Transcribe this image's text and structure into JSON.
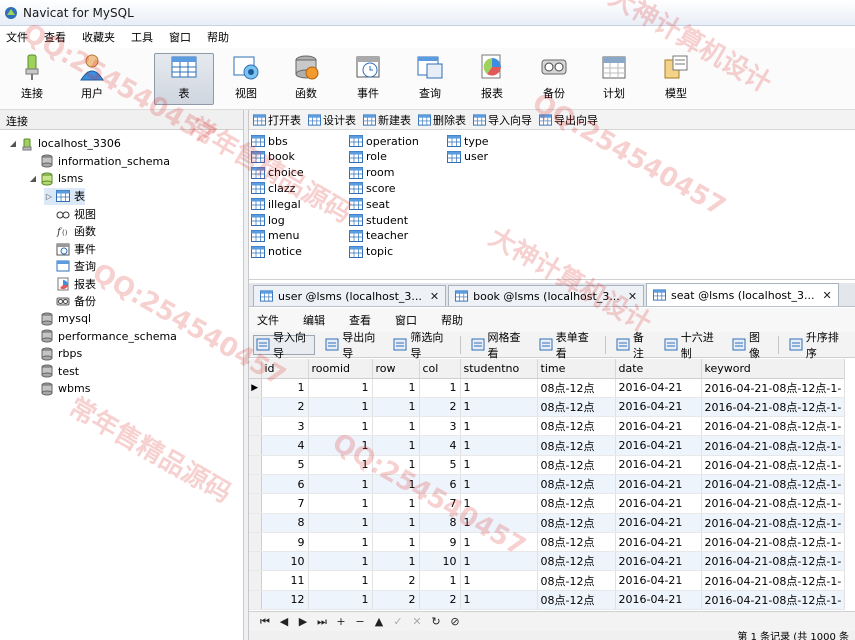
{
  "window": {
    "title": "Navicat for MySQL"
  },
  "menubar": [
    "文件",
    "查看",
    "收藏夹",
    "工具",
    "窗口",
    "帮助"
  ],
  "toolbar": [
    {
      "label": "连接",
      "icon": "connect-icon",
      "active": false
    },
    {
      "label": "用户",
      "icon": "user-icon",
      "active": false
    },
    {
      "label": "表",
      "icon": "table-icon",
      "active": true
    },
    {
      "label": "视图",
      "icon": "view-icon",
      "active": false
    },
    {
      "label": "函数",
      "icon": "function-icon",
      "active": false
    },
    {
      "label": "事件",
      "icon": "event-icon",
      "active": false
    },
    {
      "label": "查询",
      "icon": "query-icon",
      "active": false
    },
    {
      "label": "报表",
      "icon": "report-icon",
      "active": false
    },
    {
      "label": "备份",
      "icon": "backup-icon",
      "active": false
    },
    {
      "label": "计划",
      "icon": "schedule-icon",
      "active": false
    },
    {
      "label": "模型",
      "icon": "model-icon",
      "active": false
    }
  ],
  "left": {
    "header": "连接",
    "tree": [
      {
        "label": "localhost_3306",
        "level": 0,
        "arrow": "◢",
        "icon": "server-icon"
      },
      {
        "label": "information_schema",
        "level": 1,
        "arrow": "",
        "icon": "database-icon"
      },
      {
        "label": "lsms",
        "level": 1,
        "arrow": "◢",
        "icon": "database-open-icon"
      },
      {
        "label": "表",
        "level": 2,
        "arrow": "▷",
        "icon": "table-icon",
        "selected": true
      },
      {
        "label": "视图",
        "level": 2,
        "arrow": "",
        "icon": "view-icon"
      },
      {
        "label": "函数",
        "level": 2,
        "arrow": "",
        "icon": "function-icon"
      },
      {
        "label": "事件",
        "level": 2,
        "arrow": "",
        "icon": "event-icon"
      },
      {
        "label": "查询",
        "level": 2,
        "arrow": "",
        "icon": "query-icon"
      },
      {
        "label": "报表",
        "level": 2,
        "arrow": "",
        "icon": "report-icon"
      },
      {
        "label": "备份",
        "level": 2,
        "arrow": "",
        "icon": "backup-icon"
      },
      {
        "label": "mysql",
        "level": 1,
        "arrow": "",
        "icon": "database-icon"
      },
      {
        "label": "performance_schema",
        "level": 1,
        "arrow": "",
        "icon": "database-icon"
      },
      {
        "label": "rbps",
        "level": 1,
        "arrow": "",
        "icon": "database-icon"
      },
      {
        "label": "test",
        "level": 1,
        "arrow": "",
        "icon": "database-icon"
      },
      {
        "label": "wbms",
        "level": 1,
        "arrow": "",
        "icon": "database-icon"
      }
    ]
  },
  "objtoolbar": [
    "打开表",
    "设计表",
    "新建表",
    "删除表",
    "导入向导",
    "导出向导"
  ],
  "tables": [
    [
      "bbs",
      "book",
      "choice",
      "clazz",
      "illegal",
      "log",
      "menu",
      "notice"
    ],
    [
      "operation",
      "role",
      "room",
      "score",
      "seat",
      "student",
      "teacher",
      "topic"
    ],
    [
      "type",
      "user"
    ]
  ],
  "querytabs": [
    {
      "label": "user @lsms (localhost_3...",
      "active": false
    },
    {
      "label": "book @lsms (localhost_3...",
      "active": false
    },
    {
      "label": "seat @lsms (localhost_3...",
      "active": true
    }
  ],
  "innermenu": [
    "文件",
    "编辑",
    "查看",
    "窗口",
    "帮助"
  ],
  "innertoolbar": [
    {
      "label": "导入向导",
      "active": true,
      "sep": false
    },
    {
      "label": "导出向导",
      "active": false,
      "sep": false
    },
    {
      "label": "筛选向导",
      "active": false,
      "sep": true
    },
    {
      "label": "网格查看",
      "active": false,
      "sep": false
    },
    {
      "label": "表单查看",
      "active": false,
      "sep": true
    },
    {
      "label": "备注",
      "active": false,
      "sep": false
    },
    {
      "label": "十六进制",
      "active": false,
      "sep": false
    },
    {
      "label": "图像",
      "active": false,
      "sep": true
    },
    {
      "label": "升序排序",
      "active": false,
      "sep": false
    }
  ],
  "grid": {
    "columns": [
      "id",
      "roomid",
      "row",
      "col",
      "studentno",
      "time",
      "date",
      "keyword"
    ],
    "rows": [
      [
        "1",
        "1",
        "1",
        "1",
        "1",
        "08点-12点",
        "2016-04-21",
        "2016-04-21-08点-12点-1-"
      ],
      [
        "2",
        "1",
        "1",
        "2",
        "1",
        "08点-12点",
        "2016-04-21",
        "2016-04-21-08点-12点-1-"
      ],
      [
        "3",
        "1",
        "1",
        "3",
        "1",
        "08点-12点",
        "2016-04-21",
        "2016-04-21-08点-12点-1-"
      ],
      [
        "4",
        "1",
        "1",
        "4",
        "1",
        "08点-12点",
        "2016-04-21",
        "2016-04-21-08点-12点-1-"
      ],
      [
        "5",
        "1",
        "1",
        "5",
        "1",
        "08点-12点",
        "2016-04-21",
        "2016-04-21-08点-12点-1-"
      ],
      [
        "6",
        "1",
        "1",
        "6",
        "1",
        "08点-12点",
        "2016-04-21",
        "2016-04-21-08点-12点-1-"
      ],
      [
        "7",
        "1",
        "1",
        "7",
        "1",
        "08点-12点",
        "2016-04-21",
        "2016-04-21-08点-12点-1-"
      ],
      [
        "8",
        "1",
        "1",
        "8",
        "1",
        "08点-12点",
        "2016-04-21",
        "2016-04-21-08点-12点-1-"
      ],
      [
        "9",
        "1",
        "1",
        "9",
        "1",
        "08点-12点",
        "2016-04-21",
        "2016-04-21-08点-12点-1-"
      ],
      [
        "10",
        "1",
        "1",
        "10",
        "1",
        "08点-12点",
        "2016-04-21",
        "2016-04-21-08点-12点-1-"
      ],
      [
        "11",
        "1",
        "2",
        "1",
        "1",
        "08点-12点",
        "2016-04-21",
        "2016-04-21-08点-12点-1-"
      ],
      [
        "12",
        "1",
        "2",
        "2",
        "1",
        "08点-12点",
        "2016-04-21",
        "2016-04-21-08点-12点-1-"
      ]
    ]
  },
  "navbar": [
    "⏮",
    "◀",
    "▶",
    "⏭",
    "+",
    "−",
    "▲",
    "✓",
    "✕",
    "↻",
    "⊘"
  ],
  "status": "第 1 条记录 (共 1000 条",
  "watermark": [
    "QQ:254540457",
    "大神计算机设计",
    "常年售精品源码"
  ],
  "colors": {
    "accent": "#2f6fb7",
    "selection": "#dbe8f7",
    "alt_row": "#eef4fb"
  }
}
